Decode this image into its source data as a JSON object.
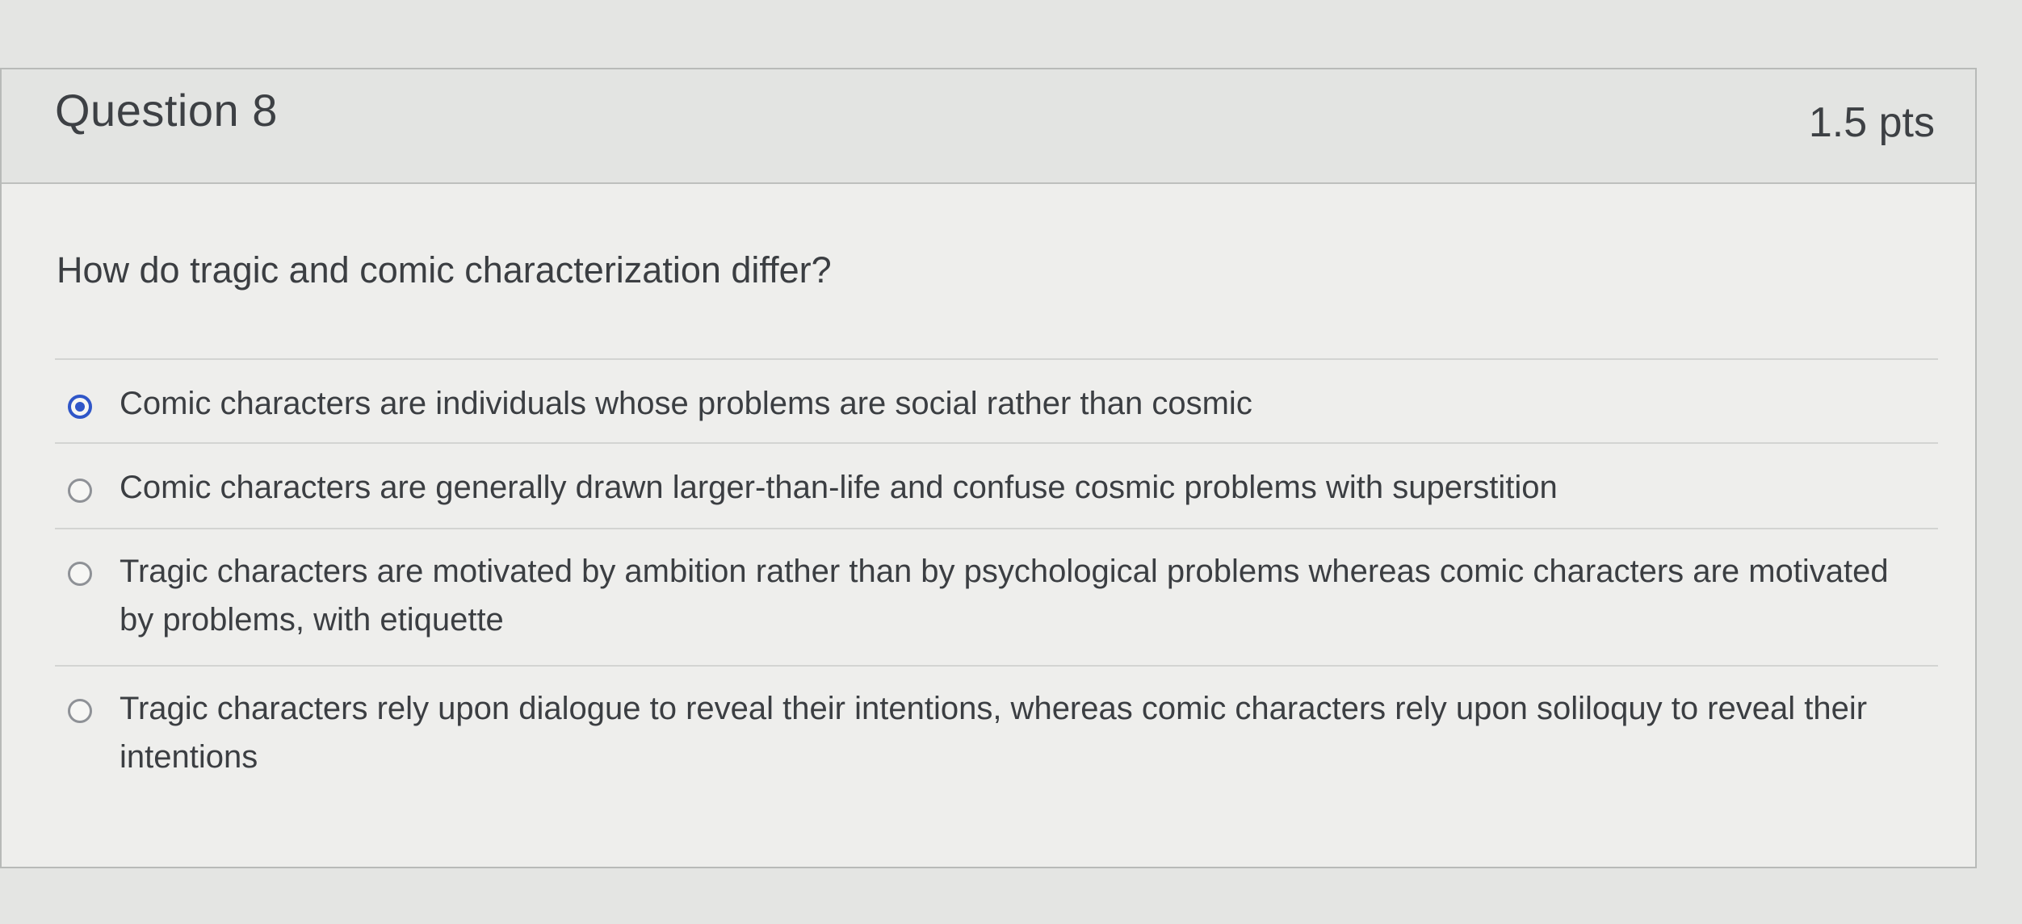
{
  "question": {
    "title": "Question 8",
    "points": "1.5 pts",
    "prompt": "How do tragic and comic characterization differ?"
  },
  "answers": [
    {
      "label": "Comic characters are individuals whose problems are social rather than cosmic",
      "selected": true
    },
    {
      "label": "Comic characters are generally drawn larger-than-life and confuse cosmic problems with superstition",
      "selected": false
    },
    {
      "label": "Tragic characters are motivated by ambition rather than by psychological problems whereas comic characters are motivated by problems, with etiquette",
      "selected": false
    },
    {
      "label": "Tragic characters rely upon dialogue to reveal their intentions, whereas comic characters rely upon soliloquy to reveal their intentions",
      "selected": false
    }
  ],
  "colors": {
    "selected_radio": "#2f56c8"
  }
}
